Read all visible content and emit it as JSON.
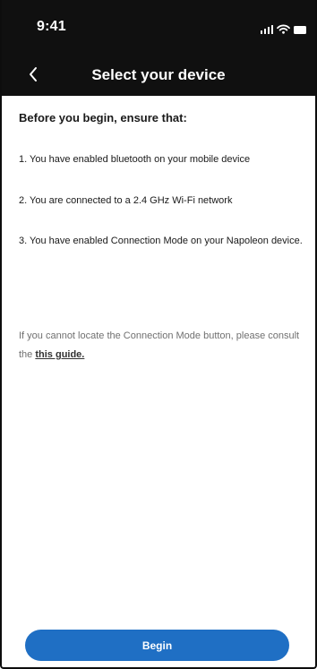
{
  "status_bar": {
    "time": "9:41",
    "icons": [
      "signal-icon",
      "wifi-icon",
      "battery-icon"
    ]
  },
  "nav": {
    "title": "Select your device",
    "back_icon": "chevron-left-icon"
  },
  "content": {
    "heading": "Before you begin, ensure that:",
    "steps": [
      "1. You have enabled bluetooth on your mobile device",
      "2. You are connected to a 2.4 GHz Wi-Fi network",
      "3. You have enabled Connection Mode on your Napoleon device."
    ],
    "help_text": "If you cannot locate the Connection Mode button, please consult the ",
    "help_link": "this guide."
  },
  "actions": {
    "begin_label": "Begin"
  },
  "colors": {
    "header_bg": "#101010",
    "primary": "#1f6fc4",
    "text": "#1a1a1a",
    "muted_text": "#707070"
  }
}
